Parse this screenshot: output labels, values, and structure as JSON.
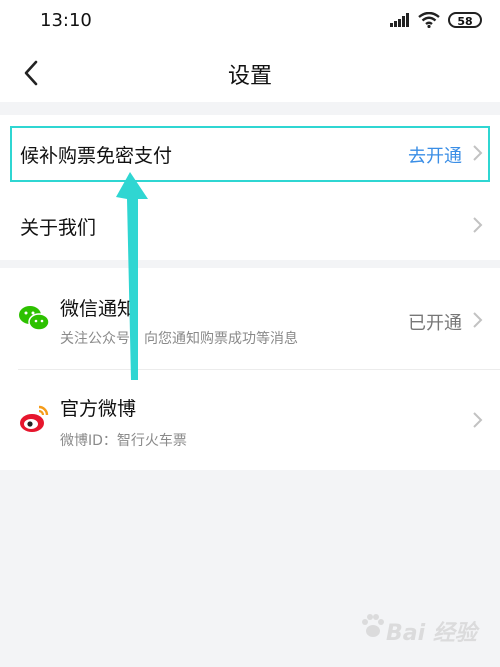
{
  "status_bar": {
    "time": "13:10",
    "battery": "58",
    "icons": [
      "signal-icon",
      "wifi-icon",
      "battery-icon"
    ]
  },
  "nav": {
    "title": "设置",
    "back_icon": "chevron-left-icon"
  },
  "settings_group_1": [
    {
      "title": "候补购票免密支付",
      "value": "去开通",
      "value_color": "#3a8ee6"
    },
    {
      "title": "关于我们"
    }
  ],
  "settings_group_2": [
    {
      "title": "微信通知",
      "subtitle": "关注公众号，向您通知购票成功等消息",
      "value": "已开通",
      "icon": "wechat-icon"
    },
    {
      "title": "官方微博",
      "subtitle": "微博ID：智行火车票",
      "icon": "weibo-icon"
    }
  ],
  "colors": {
    "accent_blue": "#3a8ee6",
    "highlight_cyan": "#2fd6d2",
    "wechat_green": "#2dc100",
    "weibo_red": "#e6162d"
  },
  "watermark": {
    "text": "Bai 经验"
  }
}
